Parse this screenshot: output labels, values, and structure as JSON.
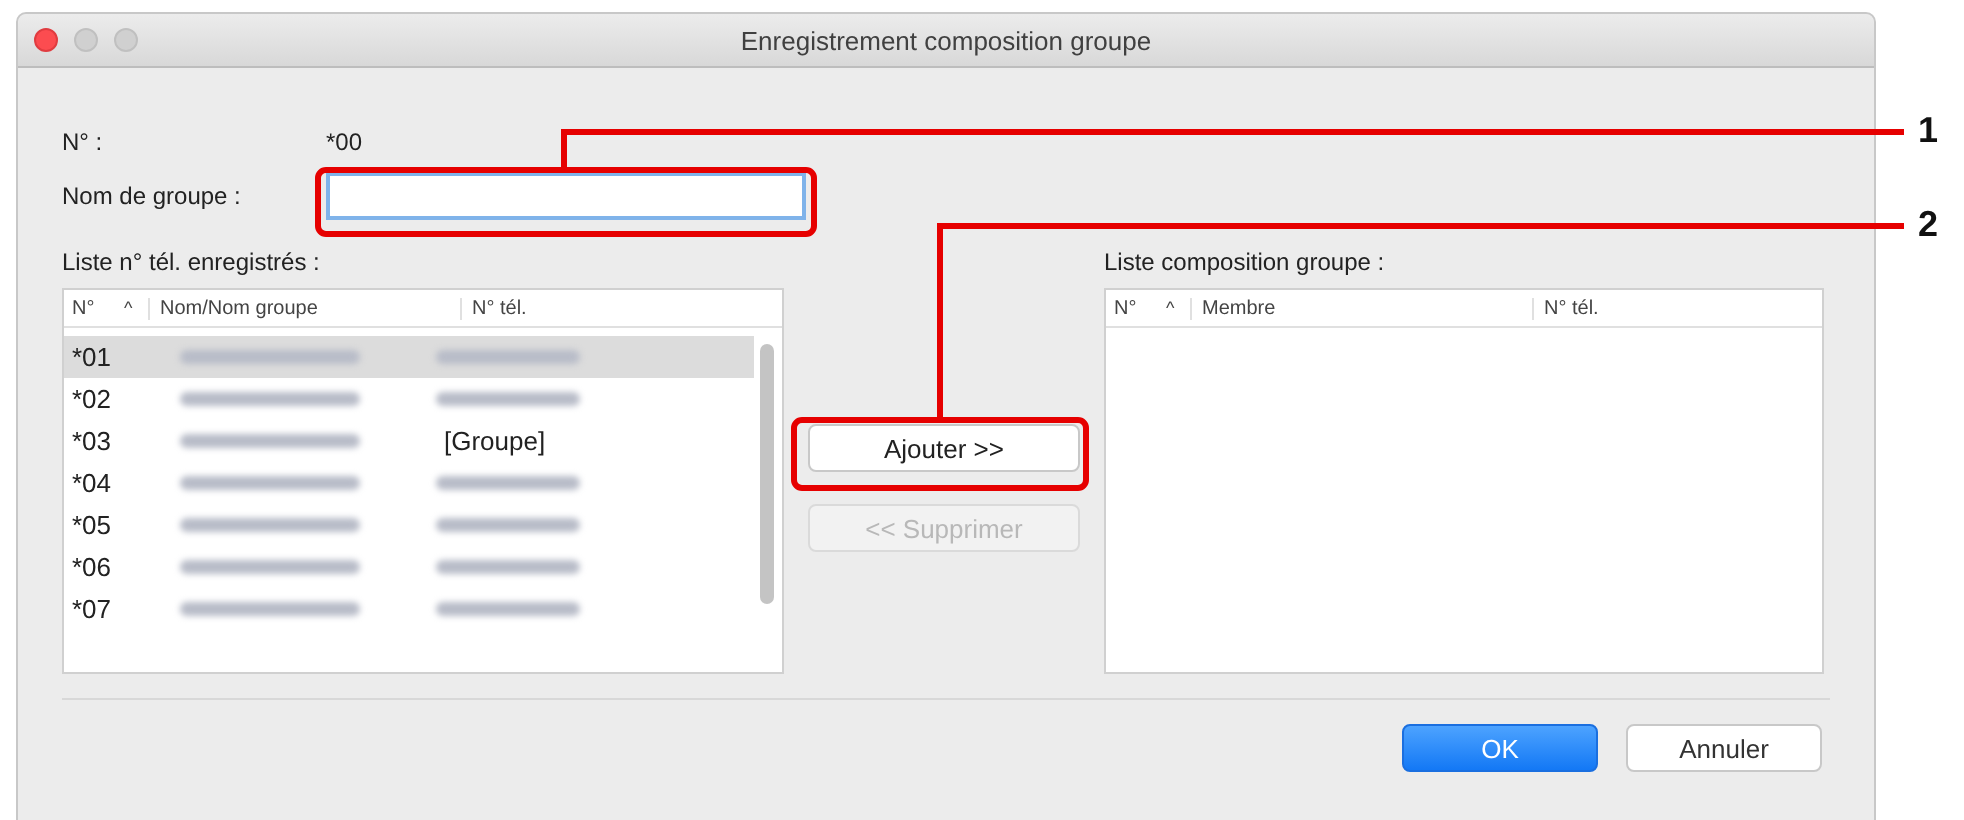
{
  "window": {
    "title": "Enregistrement composition groupe"
  },
  "number": {
    "label": "N° :",
    "value": "*00"
  },
  "group_name": {
    "label": "Nom de groupe :"
  },
  "registered_list": {
    "label": "Liste n° tél. enregistrés :",
    "columns": [
      "N°",
      "Nom/Nom groupe",
      "N° tél."
    ],
    "sort_indicator": "^",
    "rows": [
      {
        "number": "*01",
        "kind": "contact",
        "selected": true
      },
      {
        "number": "*02",
        "kind": "contact",
        "selected": false
      },
      {
        "number": "*03",
        "kind": "group",
        "phone": "[Groupe]",
        "selected": false
      },
      {
        "number": "*04",
        "kind": "contact",
        "selected": false
      },
      {
        "number": "*05",
        "kind": "contact",
        "selected": false
      },
      {
        "number": "*06",
        "kind": "contact",
        "selected": false
      },
      {
        "number": "*07",
        "kind": "contact",
        "selected": false
      }
    ]
  },
  "add_button": {
    "label": "Ajouter >>",
    "disabled": false
  },
  "remove_button": {
    "label": "<< Supprimer",
    "disabled": true
  },
  "composition_list": {
    "label": "Liste composition groupe :",
    "columns": [
      "N°",
      "Membre",
      "N° tél."
    ],
    "sort_indicator": "^"
  },
  "buttons": [
    {
      "label": "OK",
      "kind": "primary"
    },
    {
      "label": "Annuler",
      "kind": "normal"
    }
  ],
  "callouts": [
    "1",
    "2"
  ]
}
